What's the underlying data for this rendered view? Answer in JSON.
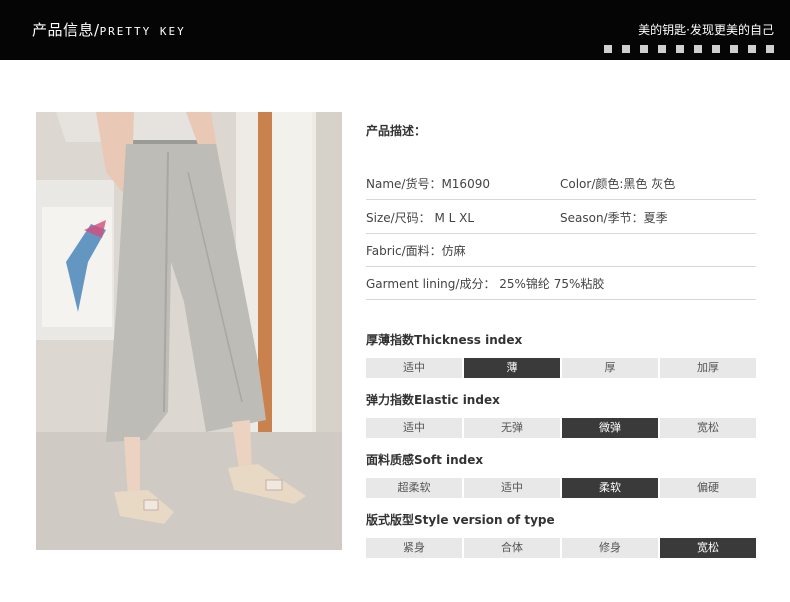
{
  "header": {
    "title_cn": "产品信息/",
    "title_en": "PRETTY KEY",
    "slogan": "美的钥匙·发现更美的自己"
  },
  "photo": {
    "subject": "grey wide-leg cropped linen pants worn with beige flats"
  },
  "description": {
    "heading": "产品描述：",
    "rows": [
      {
        "left": "Name/货号：M16090",
        "right": "Color/颜色:黑色 灰色"
      },
      {
        "left": "Size/尺码： M L XL",
        "right": "Season/季节：夏季"
      },
      {
        "left": "Fabric/面料：仿麻",
        "right": ""
      },
      {
        "left": "Garment lining/成分： 25%锦纶 75%粘胶",
        "right": ""
      }
    ]
  },
  "indices": [
    {
      "title": "厚薄指数Thickness index",
      "options": [
        "适中",
        "薄",
        "厚",
        "加厚"
      ],
      "selected": 1
    },
    {
      "title": "弹力指数Elastic index",
      "options": [
        "适中",
        "无弹",
        "微弹",
        "宽松"
      ],
      "selected": 2
    },
    {
      "title": "面料质感Soft index",
      "options": [
        "超柔软",
        "适中",
        "柔软",
        "偏硬"
      ],
      "selected": 2
    },
    {
      "title": "版式版型Style version of type",
      "options": [
        "紧身",
        "合体",
        "修身",
        "宽松"
      ],
      "selected": 3
    }
  ],
  "colors": {
    "header_bg": "#050505",
    "selected": "#3a3a3a",
    "unselected": "#e8e8e8"
  }
}
